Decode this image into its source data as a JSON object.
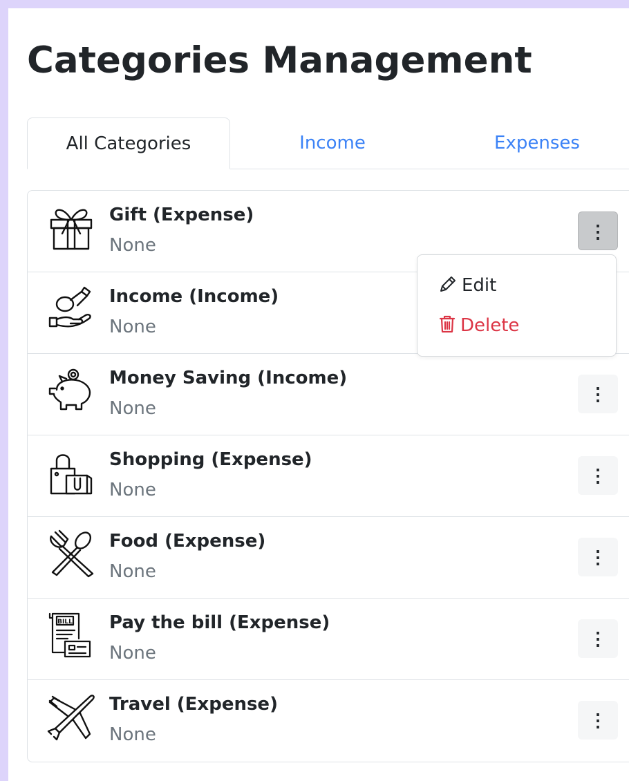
{
  "page": {
    "title": "Categories Management"
  },
  "tabs": [
    {
      "label": "All Categories",
      "active": true
    },
    {
      "label": "Income",
      "active": false
    },
    {
      "label": "Expenses",
      "active": false
    }
  ],
  "categories": [
    {
      "name": "Gift (Expense)",
      "description": "None",
      "icon": "gift-icon"
    },
    {
      "name": "Income (Income)",
      "description": "None",
      "icon": "hand-coin-icon"
    },
    {
      "name": "Money Saving (Income)",
      "description": "None",
      "icon": "piggy-bank-icon"
    },
    {
      "name": "Shopping (Expense)",
      "description": "None",
      "icon": "shopping-bags-icon"
    },
    {
      "name": "Food (Expense)",
      "description": "None",
      "icon": "fork-spoon-icon"
    },
    {
      "name": "Pay the bill (Expense)",
      "description": "None",
      "icon": "bill-icon",
      "icon_text": "BILL"
    },
    {
      "name": "Travel (Expense)",
      "description": "None",
      "icon": "airplane-icon"
    }
  ],
  "row_menu": {
    "trigger_label": "⋮",
    "open_row": 0,
    "items": [
      {
        "label": "Edit",
        "icon": "pencil-icon"
      },
      {
        "label": "Delete",
        "icon": "trash-icon"
      }
    ]
  },
  "colors": {
    "background": "#ddd4fb",
    "link": "#3b82f6",
    "danger": "#dc3545",
    "muted": "#6c757d"
  }
}
